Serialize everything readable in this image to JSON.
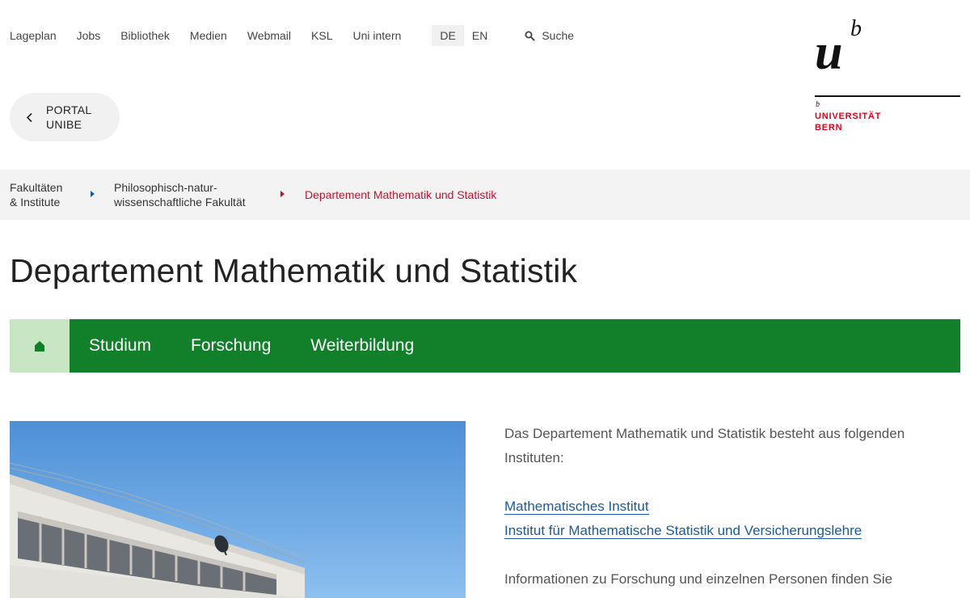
{
  "topnav": {
    "items": [
      "Lageplan",
      "Jobs",
      "Bibliothek",
      "Medien",
      "Webmail",
      "KSL",
      "Uni intern"
    ],
    "languages": [
      "DE",
      "EN"
    ],
    "active_language": "DE",
    "search_label": "Suche"
  },
  "logo": {
    "mark_u": "u",
    "mark_b": "b",
    "small_b": "b",
    "line1": "UNIVERSITÄT",
    "line2": "BERN"
  },
  "portal": {
    "line1": "PORTAL",
    "line2": "UNIBE"
  },
  "breadcrumb": {
    "item1_line1": "Fakultäten",
    "item1_line2": "& Institute",
    "item2_line1": "Philosophisch-natur-",
    "item2_line2": "wissenschaftliche Fakultät",
    "current": "Departement Mathematik und Statistik"
  },
  "page": {
    "title": "Departement Mathematik und Statistik"
  },
  "mainnav": {
    "items": [
      "Studium",
      "Forschung",
      "Weiterbildung"
    ]
  },
  "content": {
    "intro": "Das Departement Mathematik und Statistik besteht aus folgenden Instituten:",
    "links": [
      "Mathematisches Institut",
      "Institut für Mathematische Statistik und Versicherungslehre"
    ],
    "more": "Informationen zu Forschung und einzelnen Personen finden Sie"
  },
  "colors": {
    "green": "#127f2a",
    "green_light": "#c8e6c4",
    "red": "#c8102e",
    "link_blue": "#1a5aa0"
  }
}
